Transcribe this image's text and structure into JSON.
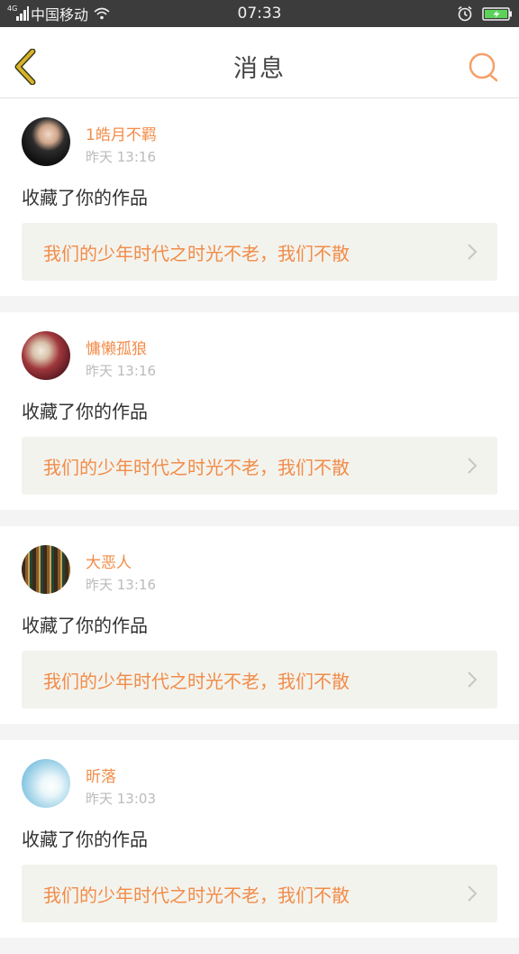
{
  "status_bar": {
    "network": "4G",
    "carrier": "中国移动",
    "time": "07:33"
  },
  "header": {
    "title": "消息",
    "back_icon": "back-chevron-icon",
    "search_icon": "search-icon"
  },
  "colors": {
    "accent": "#f28c48",
    "back_icon": "#c9a722",
    "timestamp": "#bbbbbb",
    "work_bg": "#f3f3ee"
  },
  "messages": [
    {
      "username": "1皓月不羁",
      "time": "昨天 13:16",
      "action": "收藏了你的作品",
      "work_title": "我们的少年时代之时光不老，我们不散"
    },
    {
      "username": "慵懒孤狼",
      "time": "昨天 13:16",
      "action": "收藏了你的作品",
      "work_title": "我们的少年时代之时光不老，我们不散"
    },
    {
      "username": "大恶人",
      "time": "昨天 13:16",
      "action": "收藏了你的作品",
      "work_title": "我们的少年时代之时光不老，我们不散"
    },
    {
      "username": "昕落",
      "time": "昨天 13:03",
      "action": "收藏了你的作品",
      "work_title": "我们的少年时代之时光不老，我们不散"
    }
  ]
}
